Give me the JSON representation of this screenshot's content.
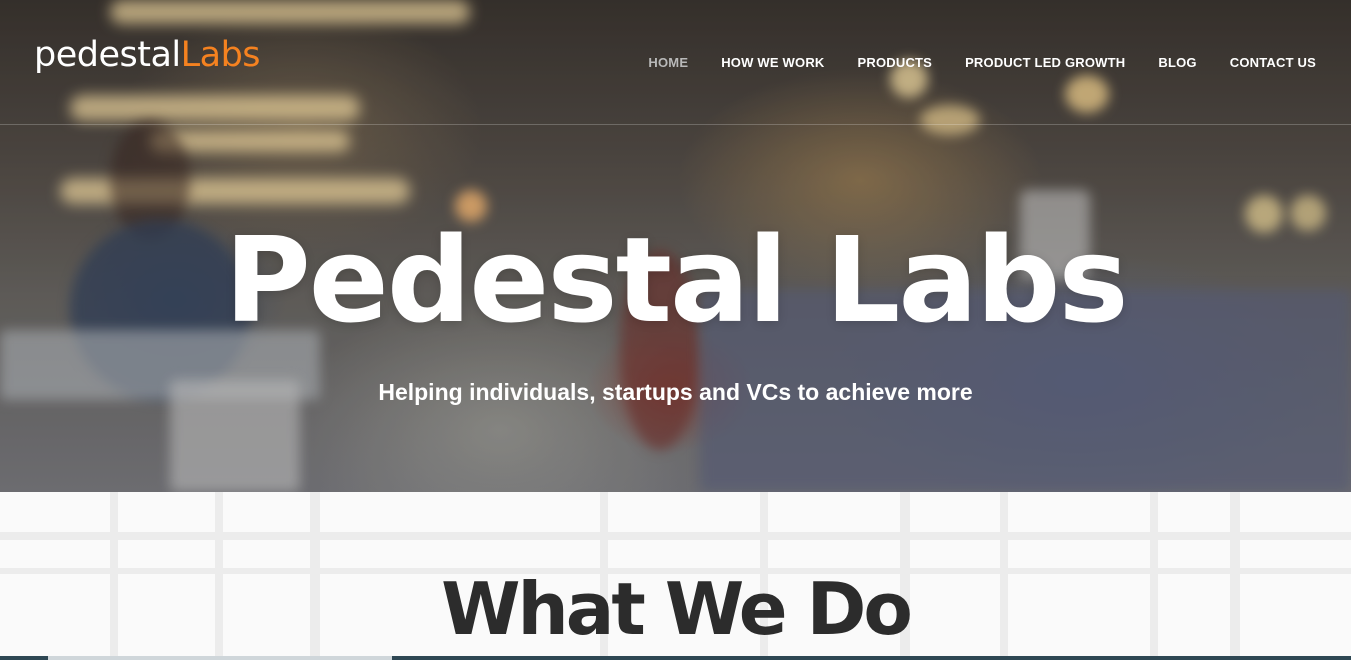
{
  "brand": {
    "logo_part1": "pedestal",
    "logo_part2": "Labs",
    "logo_accent_color": "#f58220"
  },
  "nav": {
    "items": [
      {
        "label": "HOME",
        "active": true
      },
      {
        "label": "HOW WE WORK",
        "active": false
      },
      {
        "label": "PRODUCTS",
        "active": false
      },
      {
        "label": "PRODUCT LED GROWTH",
        "active": false
      },
      {
        "label": "BLOG",
        "active": false
      },
      {
        "label": "CONTACT US",
        "active": false
      }
    ]
  },
  "hero": {
    "title": "Pedestal Labs",
    "subtitle": "Helping individuals, startups and VCs to achieve more"
  },
  "section": {
    "title": "What We Do"
  },
  "colors": {
    "text_dark": "#2c2c2c",
    "nav_active": "#b9b9b9"
  }
}
